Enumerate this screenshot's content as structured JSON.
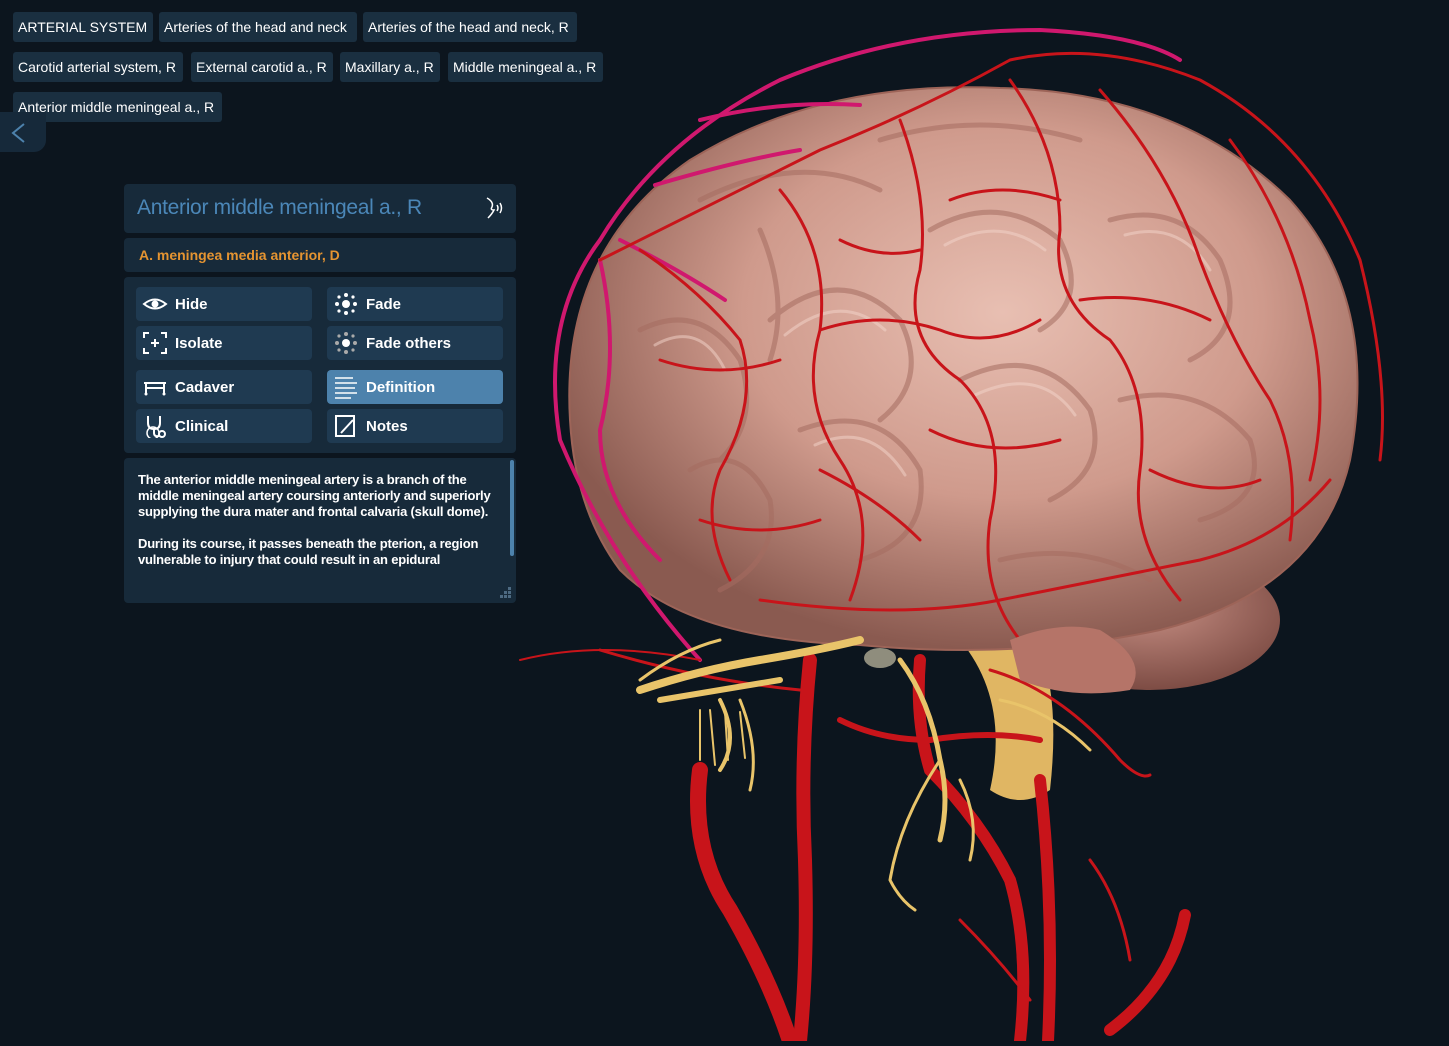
{
  "breadcrumbs": [
    "ARTERIAL SYSTEM",
    "Arteries of the head and neck",
    "Arteries of the head and neck, R",
    "Carotid arterial system, R",
    "External carotid a., R",
    "Maxillary a., R",
    "Middle meningeal a., R",
    "Anterior middle meningeal a., R"
  ],
  "panel": {
    "title": "Anterior middle meningeal a., R",
    "latin_name": "A. meningea media anterior, D",
    "actions": {
      "hide": "Hide",
      "fade": "Fade",
      "isolate": "Isolate",
      "fade_others": "Fade others",
      "cadaver": "Cadaver",
      "definition": "Definition",
      "clinical": "Clinical",
      "notes": "Notes"
    },
    "definition_paragraphs": [
      "The anterior middle meningeal artery is a branch of the middle meningeal artery coursing anteriorly and superiorly supplying the dura mater and frontal calvaria (skull dome).",
      "During its course, it passes beneath the pterion, a region vulnerable to injury that could result in an epidural"
    ]
  },
  "icons": {
    "back": "chevron-left-icon",
    "speak": "speaker-icon",
    "hide": "eye-icon",
    "fade": "fade-icon",
    "isolate": "isolate-icon",
    "fade_others": "fade-others-icon",
    "cadaver": "cadaver-table-icon",
    "definition": "definition-lines-icon",
    "clinical": "stethoscope-icon",
    "notes": "notes-icon"
  },
  "colors": {
    "background": "#0c151e",
    "panel": "#172a3a",
    "button": "#1f3a51",
    "active_button": "#4d82ac",
    "title": "#4b87b8",
    "latin": "#e59431",
    "artery": "#c8141a",
    "highlight_artery": "#d0186e",
    "nerve": "#e9c46a",
    "brain": "#d9a89a"
  },
  "scene": {
    "model": "3D brain with head and neck arteries",
    "selected_structure": "Anterior middle meningeal a., R"
  }
}
